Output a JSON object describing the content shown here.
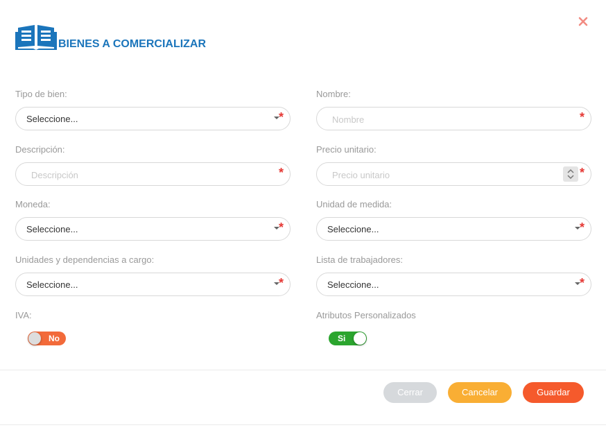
{
  "header": {
    "title": "BIENES A COMERCIALIZAR",
    "icon": "catalog-icon"
  },
  "close": {
    "icon": "close-icon",
    "color": "#f28b82"
  },
  "form": {
    "tipo_bien": {
      "label": "Tipo de bien:",
      "value": "Seleccione..."
    },
    "nombre": {
      "label": "Nombre:",
      "placeholder": "Nombre"
    },
    "descripcion": {
      "label": "Descripción:",
      "placeholder": "Descripción"
    },
    "precio": {
      "label": "Precio unitario:",
      "placeholder": "Precio unitario"
    },
    "moneda": {
      "label": "Moneda:",
      "value": "Seleccione..."
    },
    "unidad_medida": {
      "label": "Unidad de medida:",
      "value": "Seleccione..."
    },
    "unidades_dependencias": {
      "label": "Unidades y dependencias a cargo:",
      "value": "Seleccione..."
    },
    "lista_trabajadores": {
      "label": "Lista de trabajadores:",
      "value": "Seleccione..."
    },
    "iva": {
      "label": "IVA:",
      "toggle_text": "No",
      "state": "off"
    },
    "atributos": {
      "label": "Atributos Personalizados",
      "toggle_text": "Si",
      "state": "on"
    },
    "required_mark": "*"
  },
  "buttons": {
    "cerrar": "Cerrar",
    "cancelar": "Cancelar",
    "guardar": "Guardar"
  },
  "colors": {
    "brand": "#1b75bb",
    "required": "#e53935",
    "toggle_off": "#f26a3a",
    "toggle_on": "#2ba52e",
    "cerrar": "#d6d9dc",
    "cancelar": "#f9ae34",
    "guardar": "#f55a2c"
  }
}
